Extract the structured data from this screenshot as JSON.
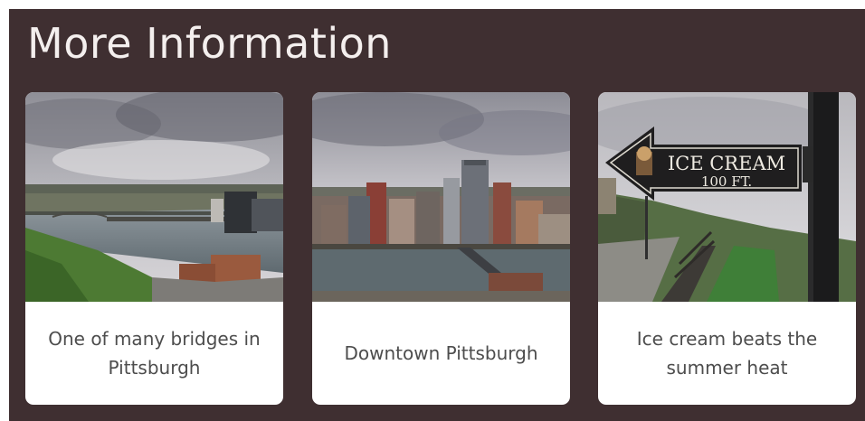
{
  "section": {
    "title": "More Information"
  },
  "cards": [
    {
      "caption": "One of many bridges in Pittsburgh",
      "image": "pittsburgh-bridges-river-photo"
    },
    {
      "caption": "Downtown Pittsburgh",
      "image": "downtown-pittsburgh-skyline-photo"
    },
    {
      "caption": "Ice cream beats the summer heat",
      "image": "ice-cream-sign-photo",
      "sign_text": [
        "ICE CREAM",
        "100 FT."
      ]
    }
  ],
  "colors": {
    "panel": "#3f2f31",
    "card": "#ffffff",
    "heading": "#f4efee",
    "caption": "#4d4d4d"
  }
}
